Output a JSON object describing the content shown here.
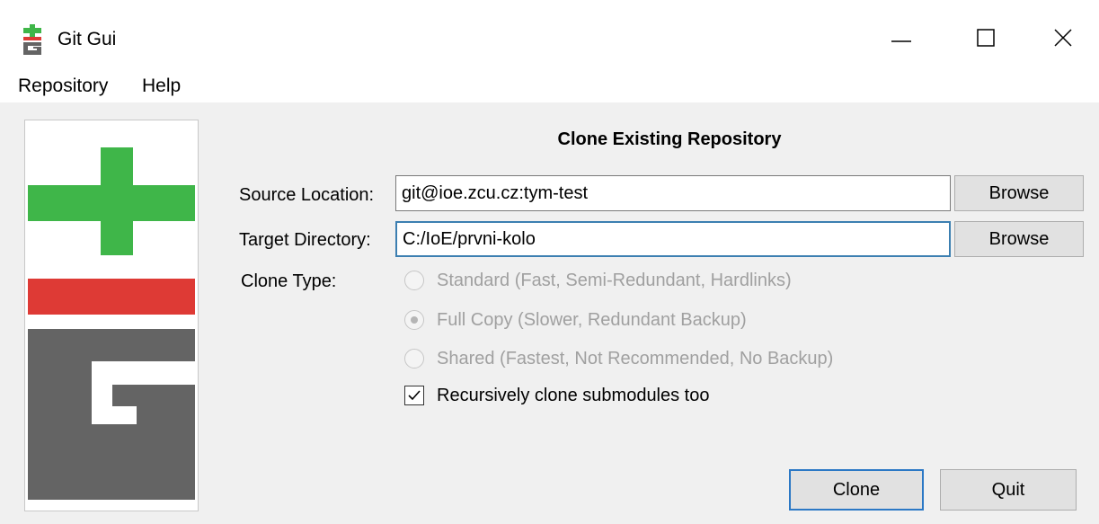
{
  "window": {
    "title": "Git Gui"
  },
  "menu": {
    "items": [
      {
        "label": "Repository"
      },
      {
        "label": "Help"
      }
    ]
  },
  "dialog": {
    "heading": "Clone Existing Repository",
    "source": {
      "label": "Source Location:",
      "value": "git@ioe.zcu.cz:tym-test",
      "browse_label": "Browse"
    },
    "target": {
      "label": "Target Directory:",
      "value": "C:/IoE/prvni-kolo",
      "browse_label": "Browse"
    },
    "clone_type": {
      "label": "Clone Type:",
      "options": [
        {
          "label": "Standard (Fast, Semi-Redundant, Hardlinks)",
          "selected": false
        },
        {
          "label": "Full Copy (Slower, Redundant Backup)",
          "selected": true
        },
        {
          "label": "Shared (Fastest, Not Recommended, No Backup)",
          "selected": false
        }
      ],
      "enabled": false
    },
    "recursive": {
      "label": "Recursively clone submodules too",
      "checked": true
    },
    "clone_button": "Clone",
    "quit_button": "Quit"
  },
  "colors": {
    "logo_green": "#3fb649",
    "logo_red": "#de3a35",
    "logo_gray": "#646464",
    "focus_blue": "#2b78c5"
  },
  "icons": {
    "app": "git-gui-icon",
    "minimize": "minimize-icon",
    "maximize": "maximize-icon",
    "close": "close-icon",
    "checkbox": "checkmark-icon"
  }
}
